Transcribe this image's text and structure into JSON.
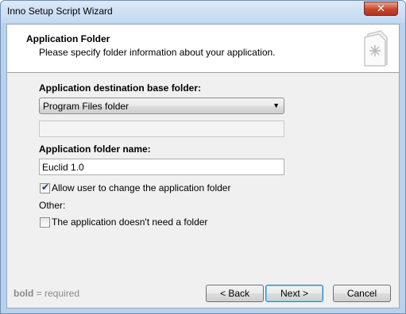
{
  "window": {
    "title": "Inno Setup Script Wizard",
    "close_glyph": "✕"
  },
  "header": {
    "title": "Application Folder",
    "subtitle": "Please specify folder information about your application.",
    "icon": "wizard-document-icon"
  },
  "form": {
    "base_folder_label": "Application destination base folder:",
    "base_folder_value": "Program Files folder",
    "custom_folder_value": "",
    "folder_name_label": "Application folder name:",
    "folder_name_value": "Euclid 1.0",
    "allow_change_label": "Allow user to change the application folder",
    "allow_change_checked": true,
    "other_label": "Other:",
    "no_folder_label": "The application doesn't need a folder",
    "no_folder_checked": false
  },
  "footer": {
    "hint_bold": "bold",
    "hint_rest": " = required",
    "back_label": "< Back",
    "next_label": "Next >",
    "cancel_label": "Cancel"
  }
}
